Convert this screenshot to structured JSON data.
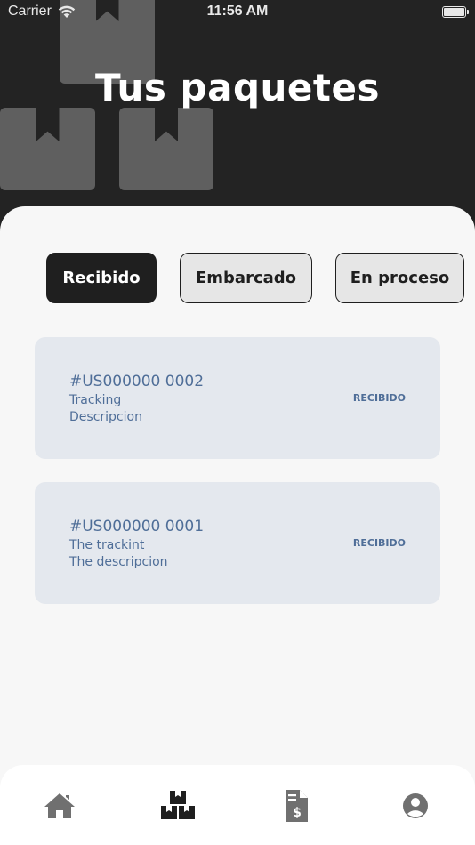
{
  "status_bar": {
    "carrier": "Carrier",
    "time": "11:56 AM"
  },
  "header": {
    "title": "Tus paquetes"
  },
  "filters": [
    {
      "label": "Recibido",
      "active": true
    },
    {
      "label": "Embarcado",
      "active": false
    },
    {
      "label": "En proceso",
      "active": false
    }
  ],
  "packages": [
    {
      "code": "#US000000 0002",
      "tracking": "Tracking",
      "description": "Descripcion",
      "status": "RECIBIDO"
    },
    {
      "code": "#US000000 0001",
      "tracking": "The trackint",
      "description": "The descripcion",
      "status": "RECIBIDO"
    }
  ],
  "tabbar": {
    "items": [
      {
        "icon": "home-icon",
        "active": false
      },
      {
        "icon": "packages-icon",
        "active": true
      },
      {
        "icon": "invoice-icon",
        "active": false
      },
      {
        "icon": "profile-icon",
        "active": false
      }
    ]
  },
  "colors": {
    "header_bg": "#232323",
    "content_bg": "#f7f7f7",
    "card_bg": "#e4e8ee",
    "card_text": "#4f6e98",
    "active_filter_bg": "#1f1f1f",
    "inactive_filter_bg": "#e6e6e6",
    "tab_icon_active": "#1f1f1f",
    "tab_icon_inactive": "#707070"
  }
}
